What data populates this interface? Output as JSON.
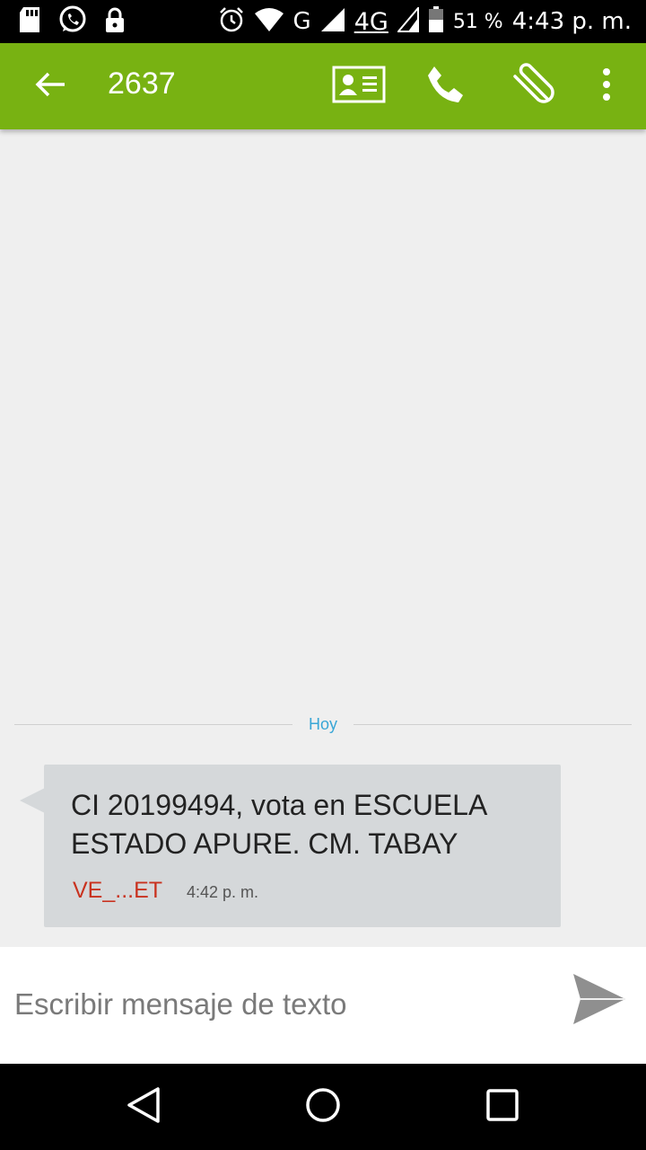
{
  "status_bar": {
    "network_g": "G",
    "network_4g": "4G",
    "battery": "51 %",
    "time": "4:43 p. m."
  },
  "app_bar": {
    "title": "2637",
    "accent_color": "#78b212"
  },
  "conversation": {
    "day_label": "Hoy",
    "messages": [
      {
        "text": "CI 20199494, vota en ESCUELA ESTADO APURE. CM. TABAY",
        "sender": "VE_...ET",
        "time": "4:42 p. m."
      }
    ]
  },
  "compose": {
    "placeholder": "Escribir mensaje de texto"
  },
  "icons": [
    "sd-card-icon",
    "whatsapp-icon",
    "lock-icon",
    "alarm-icon",
    "wifi-icon",
    "signal-icon",
    "battery-icon",
    "back-arrow-icon",
    "contact-card-icon",
    "phone-icon",
    "attachment-icon",
    "more-vert-icon",
    "send-icon",
    "nav-back-icon",
    "nav-home-icon",
    "nav-recents-icon"
  ]
}
